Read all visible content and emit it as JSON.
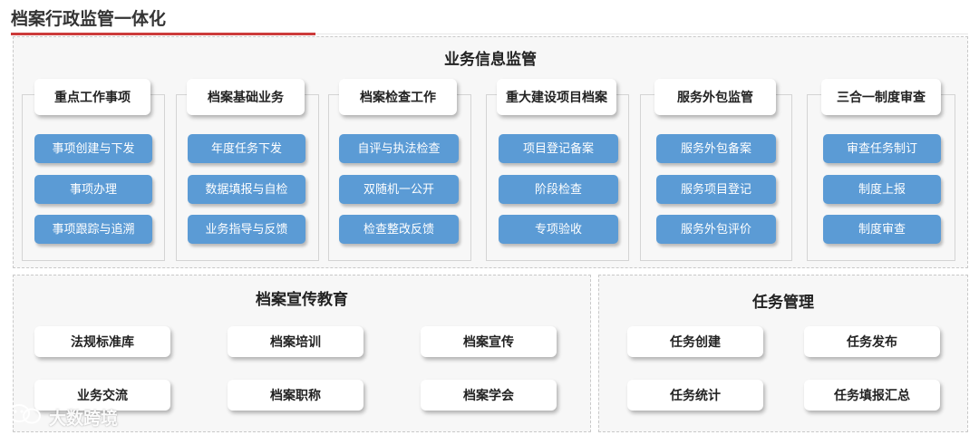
{
  "page_title": "档案行政监管一体化",
  "colors": {
    "accent": "#cc3b3b",
    "button_blue": "#5b9bd5"
  },
  "business_panel": {
    "title": "业务信息监管",
    "groups": [
      {
        "title": "重点工作事项",
        "items": [
          "事项创建与下发",
          "事项办理",
          "事项跟踪与追溯"
        ]
      },
      {
        "title": "档案基础业务",
        "items": [
          "年度任务下发",
          "数据填报与自检",
          "业务指导与反馈"
        ]
      },
      {
        "title": "档案检查工作",
        "items": [
          "自评与执法检查",
          "双随机一公开",
          "检查整改反馈"
        ]
      },
      {
        "title": "重大建设项目档案",
        "items": [
          "项目登记备案",
          "阶段检查",
          "专项验收"
        ]
      },
      {
        "title": "服务外包监管",
        "items": [
          "服务外包备案",
          "服务项目登记",
          "服务外包评价"
        ]
      },
      {
        "title": "三合一制度审查",
        "items": [
          "审查任务制订",
          "制度上报",
          "制度审查"
        ]
      }
    ]
  },
  "education_panel": {
    "title": "档案宣传教育",
    "items": [
      "法规标准库",
      "档案培训",
      "档案宣传",
      "业务交流",
      "档案职称",
      "档案学会"
    ]
  },
  "task_panel": {
    "title": "任务管理",
    "items": [
      "任务创建",
      "任务发布",
      "任务统计",
      "任务填报汇总"
    ]
  },
  "watermark": {
    "text": "大数跨境",
    "icon": "wechat-logo-icon"
  }
}
